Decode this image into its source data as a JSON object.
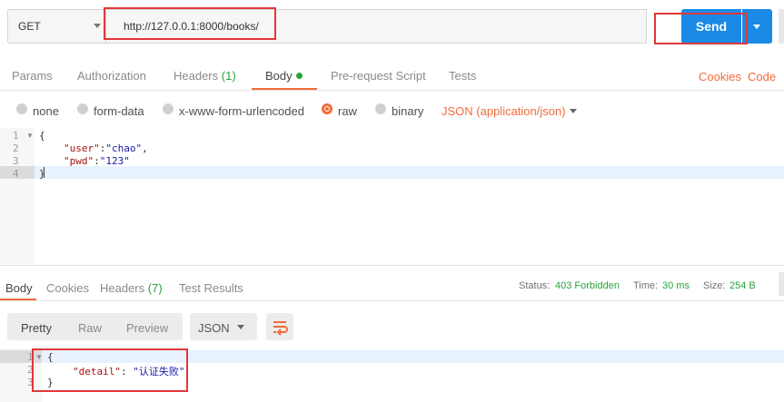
{
  "request": {
    "method": "GET",
    "url": "http://127.0.0.1:8000/books/",
    "send_label": "Send"
  },
  "request_tabs": {
    "params": "Params",
    "authorization": "Authorization",
    "headers": "Headers",
    "headers_count": "(1)",
    "body": "Body",
    "prerequest": "Pre-request Script",
    "tests": "Tests",
    "cookies": "Cookies",
    "code": "Code"
  },
  "body_types": {
    "none": "none",
    "form_data": "form-data",
    "urlencoded": "x-www-form-urlencoded",
    "raw": "raw",
    "binary": "binary",
    "selected": "raw",
    "content_type": "JSON (application/json)"
  },
  "request_body": {
    "line_numbers": [
      "1",
      "2",
      "3",
      "4"
    ],
    "open_brace": "{",
    "user_key": "\"user\"",
    "user_value": "\"chao\"",
    "pwd_key": "\"pwd\"",
    "pwd_value": "\"123\"",
    "close_brace": "}"
  },
  "response_tabs": {
    "body": "Body",
    "cookies": "Cookies",
    "headers": "Headers",
    "headers_count": "(7)",
    "test_results": "Test Results"
  },
  "response_status": {
    "status_label": "Status:",
    "status_value": "403 Forbidden",
    "time_label": "Time:",
    "time_value": "30 ms",
    "size_label": "Size:",
    "size_value": "254 B"
  },
  "response_view": {
    "pretty": "Pretty",
    "raw": "Raw",
    "preview": "Preview",
    "format": "JSON"
  },
  "response_body": {
    "line_numbers": [
      "1",
      "2",
      "3"
    ],
    "open_brace": "{",
    "detail_key": "\"detail\"",
    "detail_value": "\"认证失败\"",
    "close_brace": "}"
  },
  "colors": {
    "accent": "#f26b3a",
    "send": "#1a8ae6",
    "success": "#27a53b",
    "annotation_box": "#e0373a"
  }
}
